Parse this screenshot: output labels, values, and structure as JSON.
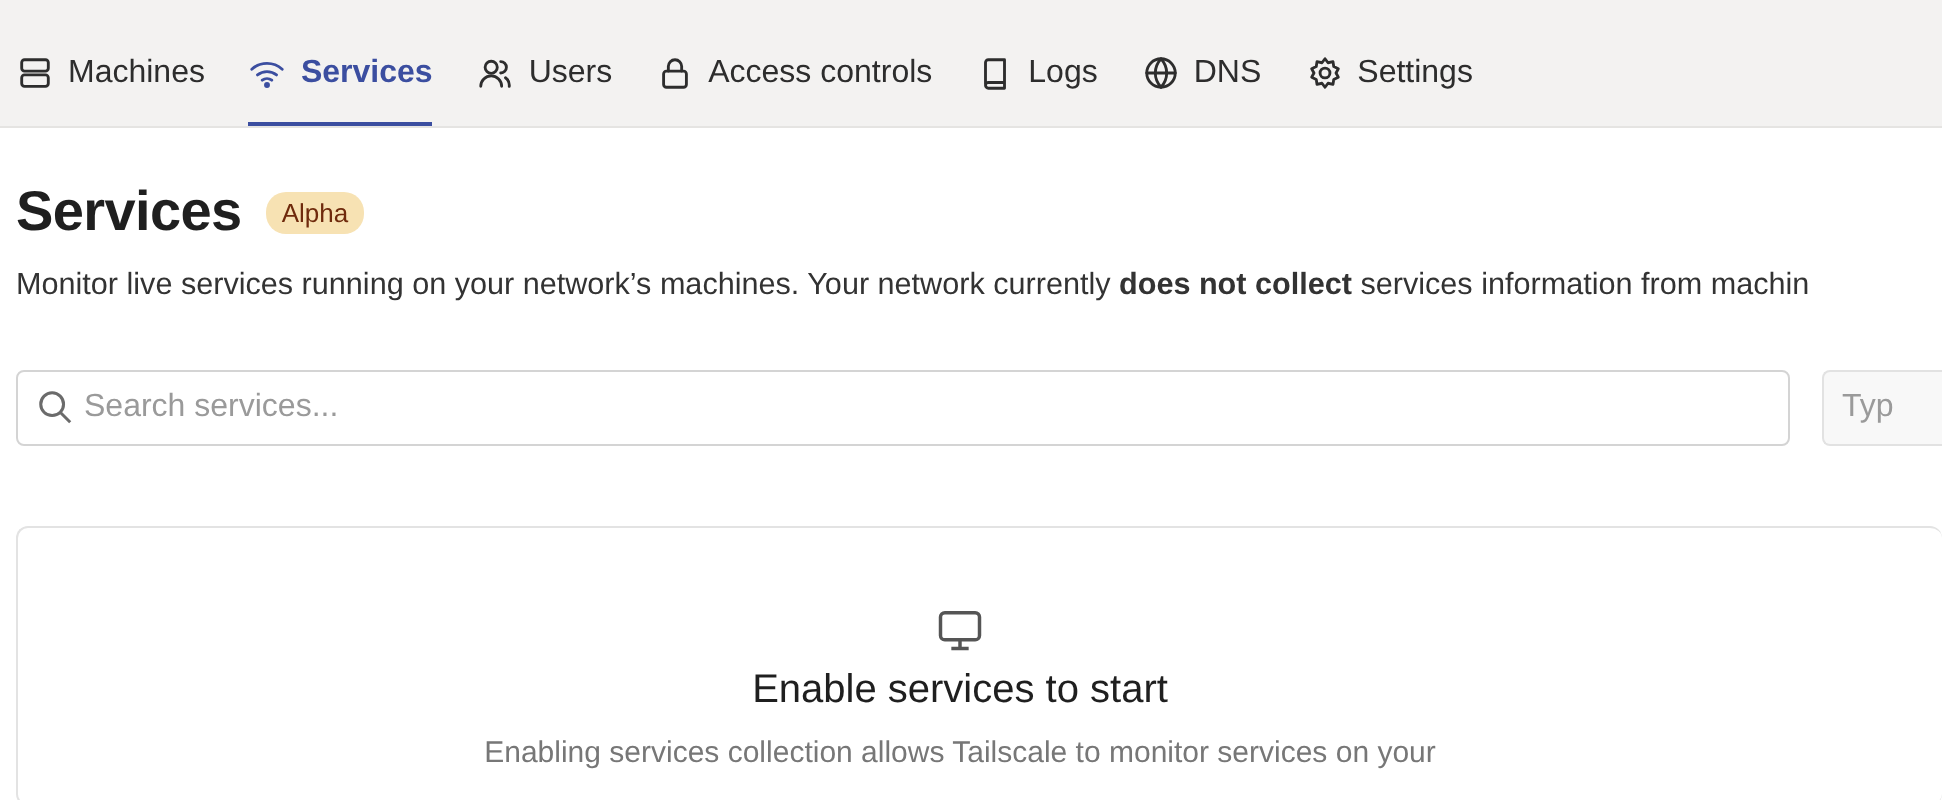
{
  "tabs": [
    {
      "label": "Machines",
      "selected": false
    },
    {
      "label": "Services",
      "selected": true
    },
    {
      "label": "Users",
      "selected": false
    },
    {
      "label": "Access controls",
      "selected": false
    },
    {
      "label": "Logs",
      "selected": false
    },
    {
      "label": "DNS",
      "selected": false
    },
    {
      "label": "Settings",
      "selected": false
    }
  ],
  "page": {
    "title": "Services",
    "badge": "Alpha",
    "description": "Monitor live services running on your network’s machines. Your network currently **does not collect** services information from machin"
  },
  "search": {
    "placeholder": "Search services..."
  },
  "type_filter": {
    "placeholder": "Typ"
  },
  "empty_state": {
    "title": "Enable services to start",
    "text": "Enabling services collection allows Tailscale to monitor services on your"
  }
}
